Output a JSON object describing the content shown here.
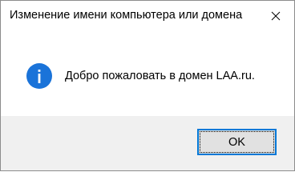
{
  "window": {
    "title": "Изменение имени компьютера или домена"
  },
  "titlebar": {
    "close_icon": "close-icon"
  },
  "content": {
    "icon": "info-icon",
    "message": "Добро пожаловать в домен LAA.ru."
  },
  "footer": {
    "ok_label": "OK"
  },
  "colors": {
    "accent": "#0078d7",
    "footer_bg": "#f0f0f0",
    "button_bg": "#e1e1e1"
  }
}
